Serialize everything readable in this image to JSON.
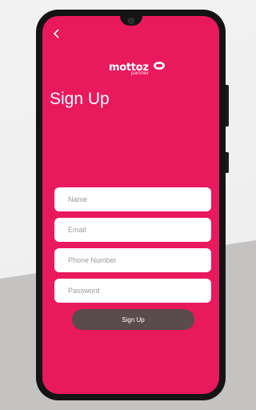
{
  "logo": {
    "wordmark": "mottoz",
    "subtitle": "partner"
  },
  "back_icon": "chevron-left-icon",
  "title": "Sign Up",
  "form": {
    "name_placeholder": "Name",
    "email_placeholder": "Email",
    "phone_placeholder": "Phone Number",
    "password_placeholder": "Password",
    "submit_label": "Sign Up"
  },
  "colors": {
    "primary": "#e8195d",
    "button": "#5a4b4d",
    "field_bg": "#ffffff",
    "phone_frame": "#141414"
  }
}
